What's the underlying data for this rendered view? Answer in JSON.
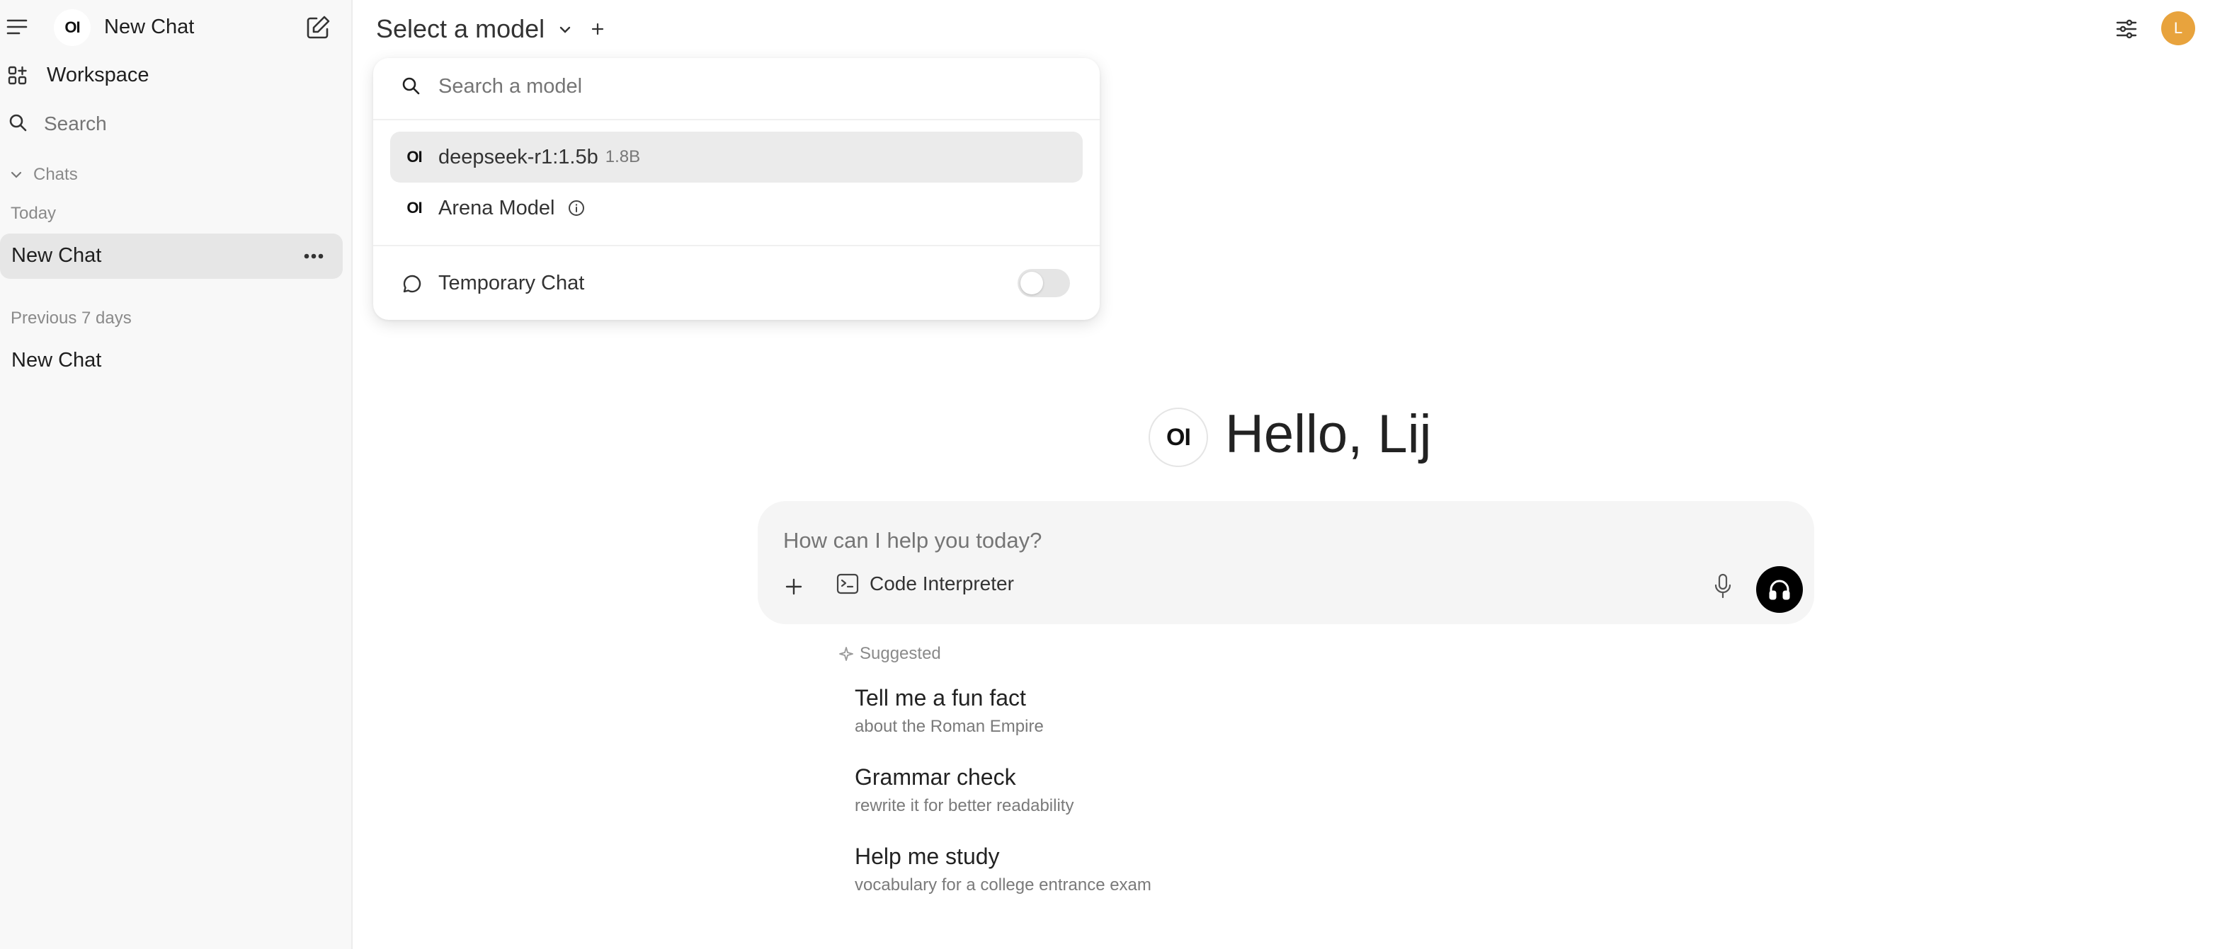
{
  "sidebar": {
    "title": "New Chat",
    "logo_text": "OI",
    "workspace_label": "Workspace",
    "search_placeholder": "Search",
    "chats_section_label": "Chats",
    "groups": [
      {
        "label": "Today",
        "items": [
          {
            "label": "New Chat",
            "active": true
          }
        ]
      },
      {
        "label": "Previous 7 days",
        "items": [
          {
            "label": "New Chat",
            "active": false
          }
        ]
      }
    ]
  },
  "topbar": {
    "model_selector_label": "Select a model",
    "user_initial": "L",
    "avatar_color": "#e8a33d"
  },
  "model_menu": {
    "search_placeholder": "Search a model",
    "models": [
      {
        "mark": "OI",
        "name": "deepseek-r1:1.5b",
        "size": "1.8B",
        "selected": true
      },
      {
        "mark": "OI",
        "name": "Arena Model",
        "size": "",
        "selected": false
      }
    ],
    "temporary_chat_label": "Temporary Chat",
    "temporary_chat_enabled": false
  },
  "main": {
    "greeting": "Hello, Lij",
    "logo_text": "OI",
    "composer": {
      "placeholder": "How can I help you today?",
      "code_interpreter_label": "Code Interpreter"
    },
    "suggested_label": "Suggested",
    "suggestions": [
      {
        "title": "Tell me a fun fact",
        "subtitle": "about the Roman Empire"
      },
      {
        "title": "Grammar check",
        "subtitle": "rewrite it for better readability"
      },
      {
        "title": "Help me study",
        "subtitle": "vocabulary for a college entrance exam"
      }
    ]
  }
}
